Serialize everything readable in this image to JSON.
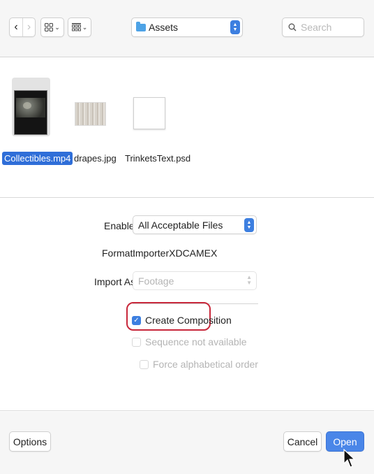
{
  "toolbar": {
    "back_glyph": "‹",
    "forward_glyph": "›",
    "view_caret": "⌄",
    "location": "Assets",
    "search_placeholder": "Search"
  },
  "files": [
    {
      "name": "Collectibles.mp4",
      "selected": true
    },
    {
      "name": "drapes.jpg",
      "selected": false
    },
    {
      "name": "TrinketsText.psd",
      "selected": false
    }
  ],
  "options": {
    "enable_label": "Enable:",
    "enable_value": "All Acceptable Files",
    "format_label": "Format:",
    "format_value": "ImporterXDCAMEX",
    "import_as_label": "Import As:",
    "import_as_value": "Footage",
    "create_composition": "Create Composition",
    "create_composition_checked": true,
    "sequence": "Sequence not available",
    "force_alpha": "Force alphabetical order"
  },
  "footer": {
    "options_label": "Options",
    "cancel_label": "Cancel",
    "open_label": "Open"
  },
  "colors": {
    "accent": "#3d7fe0",
    "highlight": "#c8283b"
  }
}
